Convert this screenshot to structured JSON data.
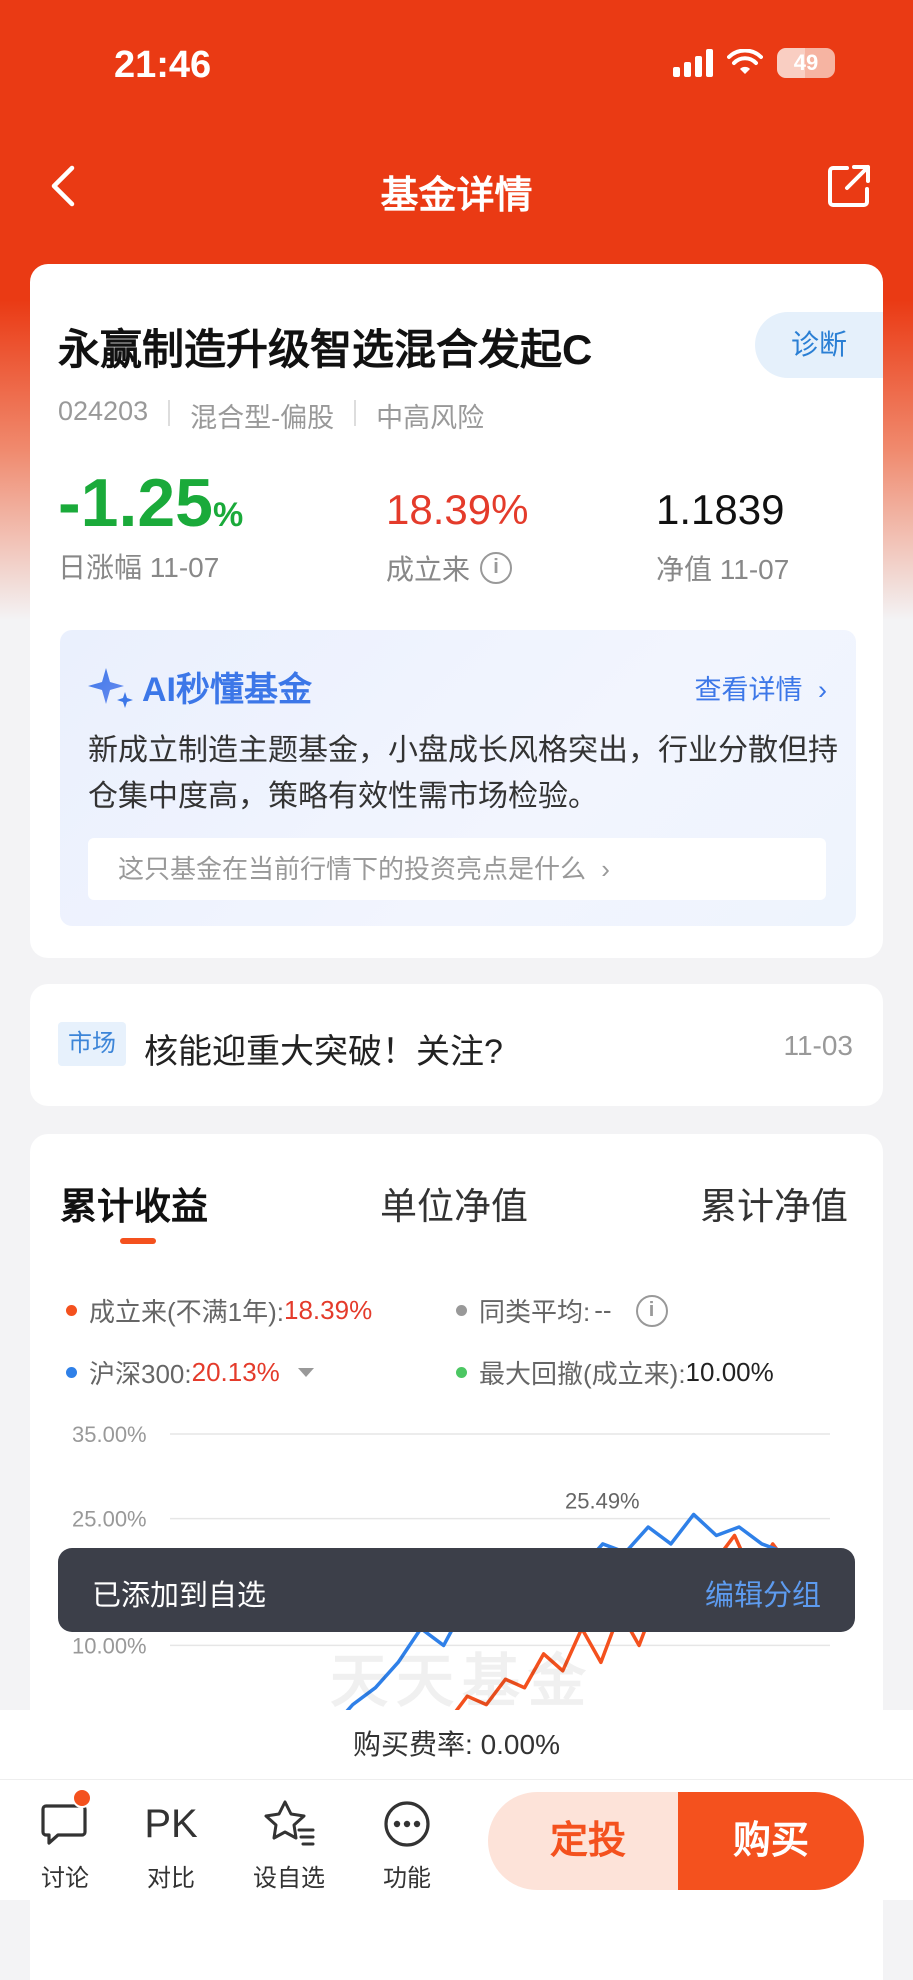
{
  "status_bar": {
    "time": "21:46",
    "battery": "49"
  },
  "nav": {
    "title": "基金详情"
  },
  "fund": {
    "name": "永赢制造升级智选混合发起C",
    "diagnose_label": "诊断",
    "code": "024203",
    "type": "混合型-偏股",
    "risk": "中高风险",
    "daily_change": "-1.25",
    "daily_change_unit": "%",
    "daily_change_label": "日涨幅 11-07",
    "since_inception": "18.39%",
    "since_inception_label": "成立来",
    "nav_value": "1.1839",
    "nav_label": "净值 11-07"
  },
  "ai": {
    "title": "AI秒懂基金",
    "more": "查看详情",
    "summary": "新成立制造主题基金，小盘成长风格突出，行业分散但持仓集中度高，策略有效性需市场检验。",
    "question": "这只基金在当前行情下的投资亮点是什么"
  },
  "news": {
    "tag": "市场",
    "title": "核能迎重大突破！关注?",
    "date": "11-03"
  },
  "chart_tabs": [
    "累计收益",
    "单位净值",
    "累计净值"
  ],
  "legend": {
    "since_label": "成立来(不满1年):",
    "since_value": "18.39%",
    "avg_label": "同类平均:",
    "avg_value": "--",
    "hs300_label": "沪深300:",
    "hs300_value": "20.13%",
    "drawdown_label": "最大回撤(成立来):",
    "drawdown_value": "10.00%"
  },
  "colors": {
    "brand": "#ea3a14",
    "fund_line": "#f4511e",
    "hs300_line": "#2f80e8",
    "avg_line": "#999999",
    "drawdown": "#4cc763",
    "down": "#1aaa3a",
    "up": "#e43b2b"
  },
  "chart_data": {
    "type": "line",
    "ylabel": "",
    "yticks": [
      "35.00%",
      "25.00%",
      "10.00%"
    ],
    "ylim": [
      0,
      35
    ],
    "peak_label": "25.49%",
    "series": [
      {
        "name": "成立来",
        "values": [
          0,
          2,
          1,
          4,
          3,
          6,
          5,
          9,
          7,
          12,
          8,
          14,
          10,
          16,
          13,
          18,
          20,
          23,
          18,
          22,
          19,
          21,
          18.39
        ]
      },
      {
        "name": "沪深300",
        "values": [
          0,
          3,
          5,
          8,
          12,
          10,
          15,
          13,
          18,
          16,
          20,
          19,
          22,
          21,
          24,
          22,
          25.49,
          23,
          24,
          22,
          21,
          20.5,
          20.13
        ]
      }
    ]
  },
  "watermark": "天天基金",
  "toast": {
    "message": "已添加到自选",
    "action": "编辑分组"
  },
  "fee": "购买费率: 0.00%",
  "bottom": {
    "discuss": "讨论",
    "pk": "PK",
    "compare": "对比",
    "favorite": "设自选",
    "function": "功能",
    "dingtou": "定投",
    "buy": "购买"
  }
}
